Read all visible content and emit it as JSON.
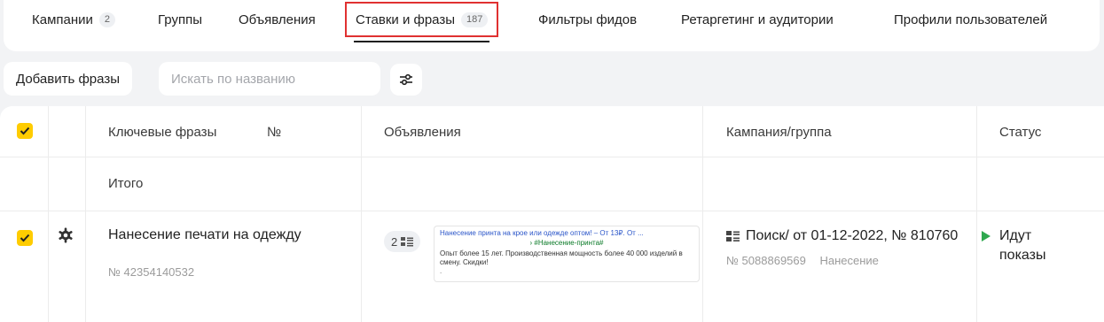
{
  "tabs": [
    {
      "label": "Кампании",
      "count": "2"
    },
    {
      "label": "Группы"
    },
    {
      "label": "Объявления"
    },
    {
      "label": "Ставки и фразы",
      "count": "187"
    },
    {
      "label": "Фильтры фидов"
    },
    {
      "label": "Ретаргетинг и аудитории"
    },
    {
      "label": "Профили пользователей"
    }
  ],
  "toolbar": {
    "add_label": "Добавить фразы",
    "search_placeholder": "Искать по названию",
    "filter_icon": "sliders-icon"
  },
  "table": {
    "headers": {
      "phrases": "Ключевые фразы",
      "number": "№",
      "ads": "Объявления",
      "campaign": "Кампания/группа",
      "status": "Статус"
    },
    "total_label": "Итого",
    "row": {
      "phrase": "Нанесение печати на одежду",
      "phrase_id": "№ 42354140532",
      "ads_count": "2",
      "ad": {
        "title": "Нанесение принта на крое или одежде оптом! – От 13₽. От ...",
        "url": "› #Нанесение-принта#",
        "text": "Опыт более 15 лет. Производственная мощность более 40 000 изделий в смену. Скидки!",
        "dot": "."
      },
      "campaign": "Поиск/ от 01-12-2022, № 810760",
      "campaign_id": "№ 5088869569",
      "group": "Нанесение",
      "status": "Идут показы"
    }
  },
  "colors": {
    "accent": "#ffcc00",
    "highlight": "#e03131",
    "status_green": "#2fa84f"
  }
}
